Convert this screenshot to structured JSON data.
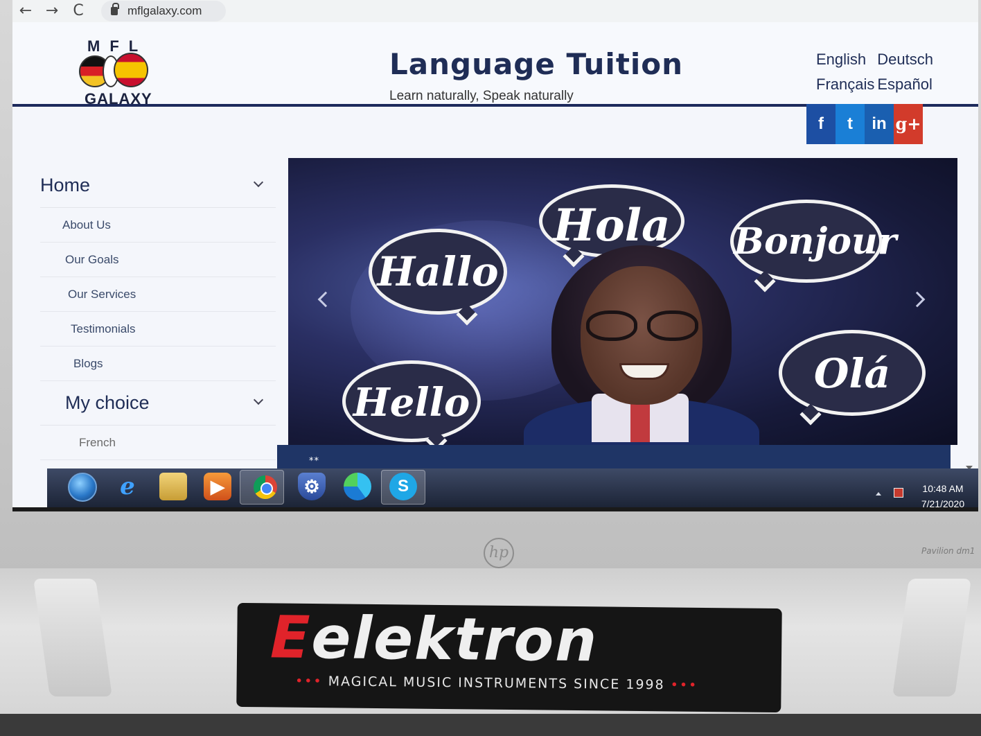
{
  "browser": {
    "url": "mflgalaxy.com",
    "back_icon": "←",
    "forward_icon": "→",
    "reload_icon": "C"
  },
  "site": {
    "logo_top": "MFL",
    "logo_bottom": "GALAXY",
    "title": "Language Tuition",
    "tagline": "Learn naturally, Speak naturally",
    "languages": [
      "English",
      "Deutsch",
      "Français",
      "Español"
    ]
  },
  "social": {
    "facebook": "f",
    "twitter": "t",
    "linkedin": "in",
    "googleplus": "g+"
  },
  "sidebar": {
    "home_label": "Home",
    "home_items": [
      "About Us",
      "Our Goals",
      "Our Services",
      "Testimonials",
      "Blogs"
    ],
    "choice_label": "My choice",
    "choice_items": [
      "French"
    ]
  },
  "hero": {
    "bubbles": [
      "Hallo",
      "Hola",
      "Bonjour",
      "Hello",
      "Olá"
    ],
    "caption_marker": "**"
  },
  "taskbar": {
    "time": "10:48 AM",
    "date": "7/21/2020",
    "skype_letter": "S"
  },
  "device": {
    "brand_logo": "hp",
    "model": "Pavilion dm1"
  },
  "sticker": {
    "brand_first": "E",
    "brand_rest": "elektron",
    "tagline": "MAGICAL MUSIC INSTRUMENTS SINCE 1998",
    "tagline_dots": "•••"
  },
  "colors": {
    "brand_navy": "#1f2d56",
    "facebook": "#1d4fa3",
    "twitter": "#1a7fd6",
    "linkedin": "#1a5fb0",
    "googleplus": "#d23b2b",
    "elektron_red": "#e0232a"
  }
}
